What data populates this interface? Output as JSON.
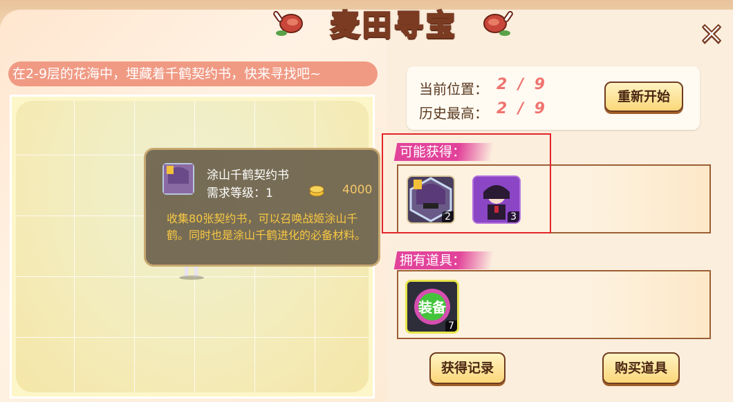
{
  "title": "麦田寻宝",
  "close_label": "✕",
  "hint_text": "在2-9层的花海中，埋藏着千鹤契约书，快来寻找吧~",
  "status": {
    "current_label": "当前位置：",
    "current_value": "2 / 9",
    "best_label": "历史最高：",
    "best_value": "2 / 9",
    "restart_label": "重新开始"
  },
  "rewards": {
    "header": "可能获得：",
    "items": [
      {
        "name": "涂山千鹤契约书",
        "icon": "contract-scroll-icon",
        "count": "2"
      },
      {
        "name": "chibi-character-card",
        "icon": "character-card-icon",
        "count": "3"
      }
    ]
  },
  "inventory": {
    "header": "拥有道具：",
    "items": [
      {
        "label": "装备",
        "icon": "equipment-orb-icon",
        "count": "7"
      }
    ]
  },
  "tooltip": {
    "name": "涂山千鹤契约书",
    "level": "需求等级：1",
    "price": "4000",
    "description": "收集80张契约书，可以召唤战姬涂山千鹤。同时也是涂山千鹤进化的必备材料。"
  },
  "buttons": {
    "records": "获得记录",
    "buy": "购买道具"
  },
  "colors": {
    "accent_pink": "#e2439a",
    "value_red": "#f0736e",
    "highlight_red": "#e2232a",
    "gold": "#f8c842"
  }
}
